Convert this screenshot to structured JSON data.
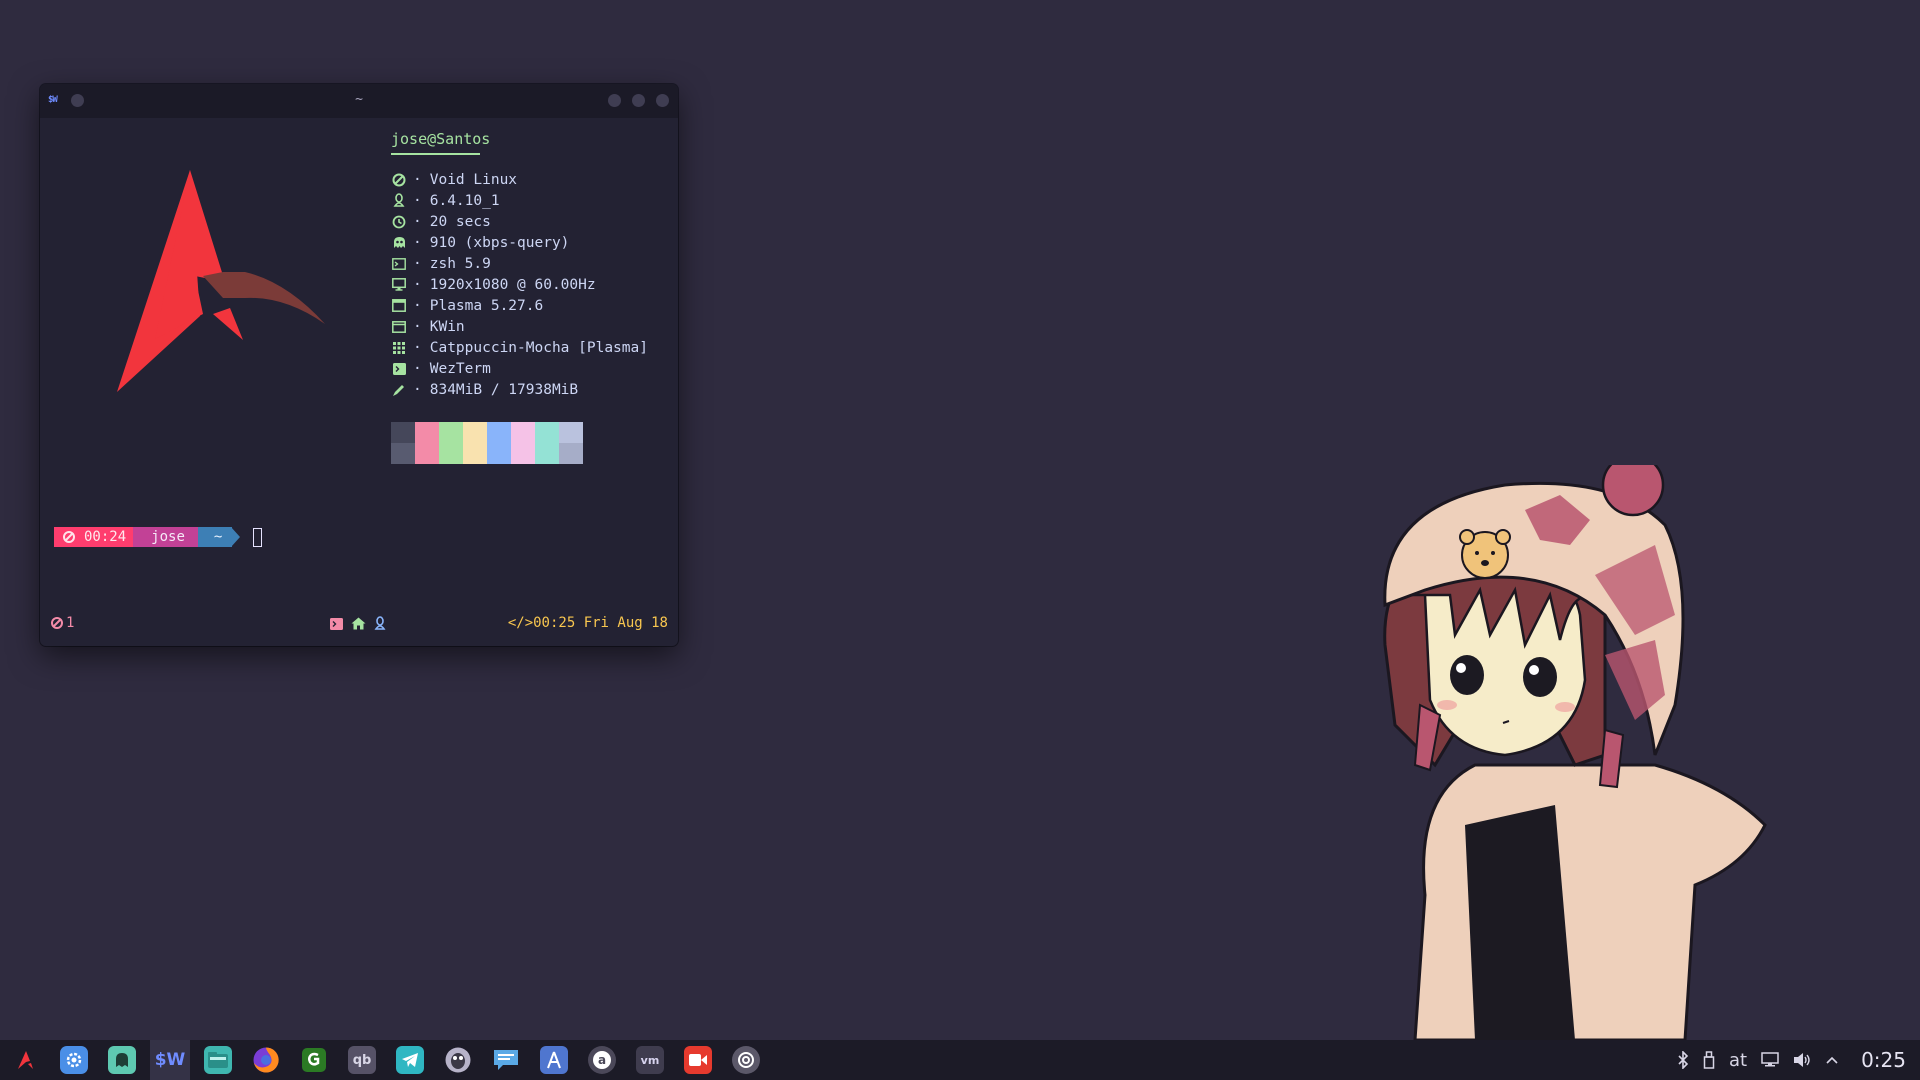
{
  "desktop": {
    "background": "#2f2b3f"
  },
  "window": {
    "title": "~",
    "app_icon": "$W"
  },
  "fetch": {
    "user_host": "jose@Santos",
    "separator": "·",
    "rows": [
      {
        "icon": "void-icon",
        "value": "Void Linux"
      },
      {
        "icon": "linux-icon",
        "value": "6.4.10_1"
      },
      {
        "icon": "clock-icon",
        "value": "20 secs"
      },
      {
        "icon": "package-icon",
        "value": "910 (xbps-query)"
      },
      {
        "icon": "shell-icon",
        "value": "zsh 5.9"
      },
      {
        "icon": "monitor-icon",
        "value": "1920x1080 @ 60.00Hz"
      },
      {
        "icon": "de-icon",
        "value": "Plasma 5.27.6"
      },
      {
        "icon": "wm-icon",
        "value": "KWin"
      },
      {
        "icon": "theme-icon",
        "value": "Catppuccin-Mocha [Plasma]"
      },
      {
        "icon": "terminal-icon",
        "value": "WezTerm"
      },
      {
        "icon": "memory-icon",
        "value": "834MiB / 17938MiB"
      }
    ],
    "palette_top": [
      "#45475a",
      "#f38ba8",
      "#a6e3a1",
      "#f9e2af",
      "#89b4fa",
      "#f5c2e7",
      "#94e2d5",
      "#bac2de"
    ],
    "palette_bottom": [
      "#585b70",
      "#f38ba8",
      "#a6e3a1",
      "#f9e2af",
      "#89b4fa",
      "#f5c2e7",
      "#94e2d5",
      "#a6adc8"
    ]
  },
  "prompt": {
    "time": "00:24",
    "user": "jose",
    "dir": "~"
  },
  "statusbar": {
    "left": "1",
    "right": "</>00:25 Fri Aug 18"
  },
  "taskbar": {
    "apps": [
      {
        "name": "app-launcher-icon",
        "label": ""
      },
      {
        "name": "system-settings-icon",
        "label": ""
      },
      {
        "name": "ghost-app-icon",
        "label": ""
      },
      {
        "name": "wezterm-icon",
        "label": "$W",
        "active": true
      },
      {
        "name": "file-manager-icon",
        "label": ""
      },
      {
        "name": "firefox-icon",
        "label": ""
      },
      {
        "name": "git-icon",
        "label": ""
      },
      {
        "name": "qbittorrent-icon",
        "label": "qb"
      },
      {
        "name": "telegram-icon",
        "label": ""
      },
      {
        "name": "gimp-icon",
        "label": ""
      },
      {
        "name": "chat-icon",
        "label": ""
      },
      {
        "name": "text-editor-icon",
        "label": ""
      },
      {
        "name": "audio-app-icon",
        "label": "a"
      },
      {
        "name": "wm-app-icon",
        "label": "vm"
      },
      {
        "name": "screen-recorder-icon",
        "label": ""
      },
      {
        "name": "screenshot-icon",
        "label": ""
      }
    ],
    "tray": {
      "keyboard_layout": "at",
      "clock": "0:25"
    }
  }
}
